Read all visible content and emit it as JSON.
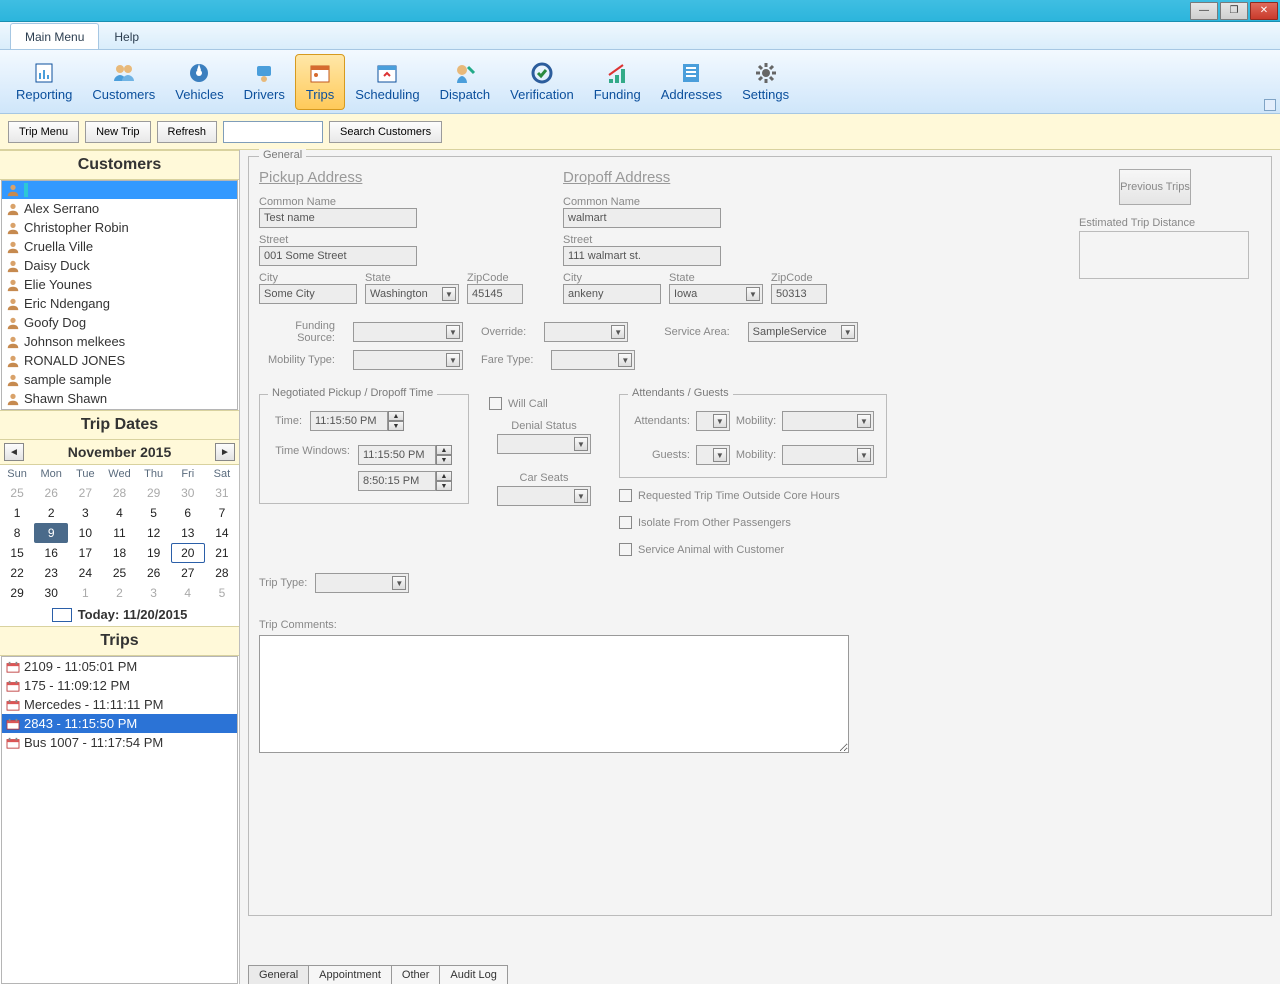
{
  "titlebar": {
    "minimize": "—",
    "maximize": "❐",
    "close": "✕"
  },
  "menubar": {
    "main_menu": "Main Menu",
    "help": "Help"
  },
  "ribbon": {
    "items": [
      {
        "label": "Reporting",
        "icon": "report"
      },
      {
        "label": "Customers",
        "icon": "customers"
      },
      {
        "label": "Vehicles",
        "icon": "vehicles"
      },
      {
        "label": "Drivers",
        "icon": "drivers"
      },
      {
        "label": "Trips",
        "icon": "trips",
        "active": true
      },
      {
        "label": "Scheduling",
        "icon": "scheduling"
      },
      {
        "label": "Dispatch",
        "icon": "dispatch"
      },
      {
        "label": "Verification",
        "icon": "verification"
      },
      {
        "label": "Funding",
        "icon": "funding"
      },
      {
        "label": "Addresses",
        "icon": "addresses"
      },
      {
        "label": "Settings",
        "icon": "settings"
      }
    ]
  },
  "toolbar": {
    "trip_menu": "Trip Menu",
    "new_trip": "New Trip",
    "refresh": "Refresh",
    "search_value": "",
    "search_customers": "Search Customers"
  },
  "sidebar": {
    "customers_header": "Customers",
    "customers": [
      {
        "name": "",
        "selected": true
      },
      {
        "name": "Alex Serrano"
      },
      {
        "name": "Christopher Robin"
      },
      {
        "name": "Cruella Ville"
      },
      {
        "name": "Daisy Duck"
      },
      {
        "name": "Elie  Younes"
      },
      {
        "name": "Eric Ndengang"
      },
      {
        "name": "Goofy Dog"
      },
      {
        "name": "Johnson melkees"
      },
      {
        "name": "RONALD JONES"
      },
      {
        "name": "sample sample"
      },
      {
        "name": "Shawn Shawn"
      }
    ],
    "trip_dates_header": "Trip Dates",
    "calendar": {
      "month_year": "November 2015",
      "dows": [
        "Sun",
        "Mon",
        "Tue",
        "Wed",
        "Thu",
        "Fri",
        "Sat"
      ],
      "weeks": [
        [
          {
            "d": "25",
            "off": true
          },
          {
            "d": "26",
            "off": true
          },
          {
            "d": "27",
            "off": true
          },
          {
            "d": "28",
            "off": true
          },
          {
            "d": "29",
            "off": true
          },
          {
            "d": "30",
            "off": true
          },
          {
            "d": "31",
            "off": true
          }
        ],
        [
          {
            "d": "1"
          },
          {
            "d": "2"
          },
          {
            "d": "3"
          },
          {
            "d": "4"
          },
          {
            "d": "5"
          },
          {
            "d": "6"
          },
          {
            "d": "7"
          }
        ],
        [
          {
            "d": "8"
          },
          {
            "d": "9",
            "sel9": true
          },
          {
            "d": "10"
          },
          {
            "d": "11"
          },
          {
            "d": "12"
          },
          {
            "d": "13"
          },
          {
            "d": "14"
          }
        ],
        [
          {
            "d": "15"
          },
          {
            "d": "16"
          },
          {
            "d": "17"
          },
          {
            "d": "18"
          },
          {
            "d": "19"
          },
          {
            "d": "20",
            "sel20": true
          },
          {
            "d": "21"
          }
        ],
        [
          {
            "d": "22"
          },
          {
            "d": "23"
          },
          {
            "d": "24"
          },
          {
            "d": "25"
          },
          {
            "d": "26"
          },
          {
            "d": "27"
          },
          {
            "d": "28"
          }
        ],
        [
          {
            "d": "29"
          },
          {
            "d": "30"
          },
          {
            "d": "1",
            "off": true
          },
          {
            "d": "2",
            "off": true
          },
          {
            "d": "3",
            "off": true
          },
          {
            "d": "4",
            "off": true
          },
          {
            "d": "5",
            "off": true
          }
        ]
      ],
      "today_label": "Today: 11/20/2015"
    },
    "trips_header": "Trips",
    "trips": [
      {
        "label": "2109 - 11:05:01 PM"
      },
      {
        "label": "175 - 11:09:12 PM"
      },
      {
        "label": "Mercedes - 11:11:11 PM"
      },
      {
        "label": "2843 - 11:15:50 PM",
        "selected": true
      },
      {
        "label": "Bus 1007 - 11:17:54 PM"
      }
    ]
  },
  "general": {
    "legend": "General",
    "previous_trips": "Previous Trips",
    "est_dist_label": "Estimated Trip Distance",
    "pickup": {
      "title": "Pickup Address",
      "common_name_label": "Common Name",
      "common_name": "Test name",
      "street_label": "Street",
      "street": "001 Some Street",
      "city_label": "City",
      "city": "Some City",
      "state_label": "State",
      "state": "Washington",
      "zip_label": "ZipCode",
      "zip": "45145"
    },
    "dropoff": {
      "title": "Dropoff Address",
      "common_name_label": "Common Name",
      "common_name": "walmart",
      "street_label": "Street",
      "street": "111 walmart st.",
      "city_label": "City",
      "city": "ankeny",
      "state_label": "State",
      "state": "Iowa",
      "zip_label": "ZipCode",
      "zip": "50313"
    },
    "mid": {
      "funding_source_label": "Funding Source:",
      "funding_source": "",
      "override_label": "Override:",
      "override": "",
      "service_area_label": "Service Area:",
      "service_area": "SampleService",
      "mobility_type_label": "Mobility Type:",
      "mobility_type": "",
      "fare_type_label": "Fare Type:",
      "fare_type": ""
    },
    "neg_time": {
      "legend": "Negotiated  Pickup / Dropoff Time",
      "time_label": "Time:",
      "time": "11:15:50 PM",
      "time_windows_label": "Time Windows:",
      "tw1": "11:15:50 PM",
      "tw2": "8:50:15 PM"
    },
    "trip_type_label": "Trip Type:",
    "trip_type": "",
    "will_call_label": "Will Call",
    "denial_status_label": "Denial Status",
    "denial_status": "",
    "car_seats_label": "Car Seats",
    "car_seats": "",
    "attendants": {
      "legend": "Attendants / Guests",
      "attendants_label": "Attendants:",
      "attendants": "",
      "a_mobility_label": "Mobility:",
      "a_mobility": "",
      "guests_label": "Guests:",
      "guests": "",
      "g_mobility_label": "Mobility:",
      "g_mobility": ""
    },
    "flags": {
      "outside_core": "Requested Trip Time Outside Core Hours",
      "isolate": "Isolate From Other Passengers",
      "service_animal": "Service Animal with Customer"
    },
    "trip_comments_label": "Trip Comments:",
    "trip_comments": ""
  },
  "bottom_tabs": {
    "general": "General",
    "appointment": "Appointment",
    "other": "Other",
    "audit_log": "Audit Log"
  }
}
